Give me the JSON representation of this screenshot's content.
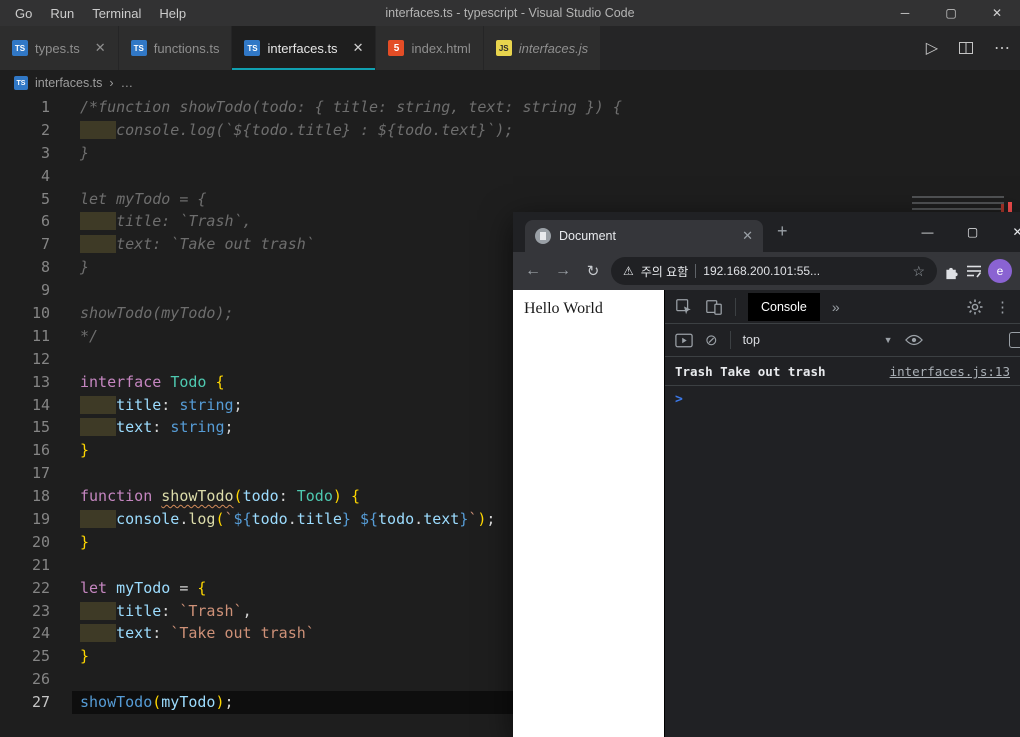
{
  "vscode": {
    "menu": [
      "Go",
      "Run",
      "Terminal",
      "Help"
    ],
    "window_title": "interfaces.ts - typescript - Visual Studio Code",
    "window_controls": {
      "minimize": "─",
      "maximize": "▢",
      "close": "✕"
    },
    "tabs": [
      {
        "label": "types.ts",
        "icon": "ts-icon"
      },
      {
        "label": "functions.ts",
        "icon": "ts-icon"
      },
      {
        "label": "interfaces.ts",
        "icon": "ts-icon"
      },
      {
        "label": "index.html",
        "icon": "html-icon"
      },
      {
        "label": "interfaces.js",
        "icon": "js-icon"
      }
    ],
    "actions": {
      "run": "▷",
      "more": "⋯"
    },
    "breadcrumb": {
      "file": "interfaces.ts",
      "sep": "›",
      "more": "…"
    },
    "icon_text": {
      "ts": "TS",
      "html": "5",
      "js": "JS"
    },
    "colors": {
      "accent": "#10a0b0",
      "ts_icon": "#3178c6",
      "html_icon": "#e44d26",
      "js_icon": "#e8d44d"
    },
    "editor": {
      "lines": [
        {
          "n": 1,
          "t": [
            [
              "cm",
              "/*function showTodo(todo: { title: string, text: string }) {"
            ]
          ]
        },
        {
          "n": 2,
          "t": [
            [
              "tab cm",
              "    "
            ],
            [
              "cm",
              "console.log(`${todo.title} : ${todo.text}`);"
            ]
          ]
        },
        {
          "n": 3,
          "t": [
            [
              "cm",
              "}"
            ]
          ]
        },
        {
          "n": 4,
          "t": []
        },
        {
          "n": 5,
          "t": [
            [
              "cm",
              "let myTodo = {"
            ]
          ]
        },
        {
          "n": 6,
          "t": [
            [
              "tab cm",
              "    "
            ],
            [
              "cm",
              "title: `Trash`,"
            ]
          ]
        },
        {
          "n": 7,
          "t": [
            [
              "tab cm",
              "    "
            ],
            [
              "cm",
              "text: `Take out trash`"
            ]
          ]
        },
        {
          "n": 8,
          "t": [
            [
              "cm",
              "}"
            ]
          ]
        },
        {
          "n": 9,
          "t": []
        },
        {
          "n": 10,
          "t": [
            [
              "cm",
              "showTodo(myTodo);"
            ]
          ]
        },
        {
          "n": 11,
          "t": [
            [
              "cm",
              "*/"
            ]
          ]
        },
        {
          "n": 12,
          "t": []
        },
        {
          "n": 13,
          "t": [
            [
              "kw",
              "interface"
            ],
            [
              "plain",
              " "
            ],
            [
              "type",
              "Todo"
            ],
            [
              "plain",
              " "
            ],
            [
              "brace",
              "{"
            ]
          ]
        },
        {
          "n": 14,
          "t": [
            [
              "tab",
              "    "
            ],
            [
              "var",
              "title"
            ],
            [
              "plain",
              ": "
            ],
            [
              "kw2",
              "string"
            ],
            [
              "plain",
              ";"
            ]
          ]
        },
        {
          "n": 15,
          "t": [
            [
              "tab",
              "    "
            ],
            [
              "var",
              "text"
            ],
            [
              "plain",
              ": "
            ],
            [
              "kw2",
              "string"
            ],
            [
              "plain",
              ";"
            ]
          ]
        },
        {
          "n": 16,
          "t": [
            [
              "brace",
              "}"
            ]
          ]
        },
        {
          "n": 17,
          "t": []
        },
        {
          "n": 18,
          "t": [
            [
              "kw",
              "function"
            ],
            [
              "plain",
              " "
            ],
            [
              "fn squiggle",
              "showTodo"
            ],
            [
              "brace",
              "("
            ],
            [
              "var",
              "todo"
            ],
            [
              "plain",
              ": "
            ],
            [
              "type",
              "Todo"
            ],
            [
              "brace",
              ")"
            ],
            [
              "plain",
              " "
            ],
            [
              "brace",
              "{"
            ]
          ]
        },
        {
          "n": 19,
          "t": [
            [
              "tab",
              "    "
            ],
            [
              "var",
              "console"
            ],
            [
              "plain",
              "."
            ],
            [
              "fn",
              "log"
            ],
            [
              "brace",
              "("
            ],
            [
              "str",
              "`"
            ],
            [
              "interp",
              "${"
            ],
            [
              "var",
              "todo"
            ],
            [
              "plain",
              "."
            ],
            [
              "var",
              "title"
            ],
            [
              "interp",
              "}"
            ],
            [
              "str",
              " "
            ],
            [
              "interp",
              "${"
            ],
            [
              "var",
              "todo"
            ],
            [
              "plain",
              "."
            ],
            [
              "var",
              "text"
            ],
            [
              "interp",
              "}"
            ],
            [
              "str",
              "`"
            ],
            [
              "brace",
              ")"
            ],
            [
              "plain",
              ";"
            ]
          ]
        },
        {
          "n": 20,
          "t": [
            [
              "brace",
              "}"
            ]
          ]
        },
        {
          "n": 21,
          "t": []
        },
        {
          "n": 22,
          "t": [
            [
              "kw",
              "let"
            ],
            [
              "plain",
              " "
            ],
            [
              "var",
              "myTodo"
            ],
            [
              "plain",
              " = "
            ],
            [
              "brace",
              "{"
            ]
          ]
        },
        {
          "n": 23,
          "t": [
            [
              "tab",
              "    "
            ],
            [
              "var",
              "title"
            ],
            [
              "plain",
              ": "
            ],
            [
              "str",
              "`Trash`"
            ],
            [
              "plain",
              ","
            ]
          ]
        },
        {
          "n": 24,
          "t": [
            [
              "tab",
              "    "
            ],
            [
              "var",
              "text"
            ],
            [
              "plain",
              ": "
            ],
            [
              "str",
              "`Take out trash`"
            ]
          ]
        },
        {
          "n": 25,
          "t": [
            [
              "brace",
              "}"
            ]
          ]
        },
        {
          "n": 26,
          "t": []
        },
        {
          "n": 27,
          "current": true,
          "t": [
            [
              "fncall",
              "showTodo"
            ],
            [
              "brace",
              "("
            ],
            [
              "var",
              "myTodo"
            ],
            [
              "brace",
              ")"
            ],
            [
              "plain",
              ";"
            ]
          ]
        }
      ]
    }
  },
  "chrome": {
    "tab_title": "Document",
    "new_tab": "+",
    "window_controls": {
      "minimize": "—",
      "maximize": "▢",
      "close": "✕"
    },
    "nav": {
      "back": "←",
      "forward": "→",
      "reload": "↻"
    },
    "address": {
      "warning_glyph": "⚠",
      "warning_text": "주의 요함",
      "url": "192.168.200.101:55...",
      "star": "☆"
    },
    "profile_initial": "e",
    "page_text": "Hello World",
    "devtools": {
      "tab_label": "Console",
      "more_tabs": "»",
      "kebab": "⋮",
      "clear_glyph": "⊘",
      "context": "top",
      "context_arrow": "▼",
      "log": {
        "message": "Trash Take out trash",
        "source": "interfaces.js:13"
      },
      "prompt": ">"
    }
  }
}
